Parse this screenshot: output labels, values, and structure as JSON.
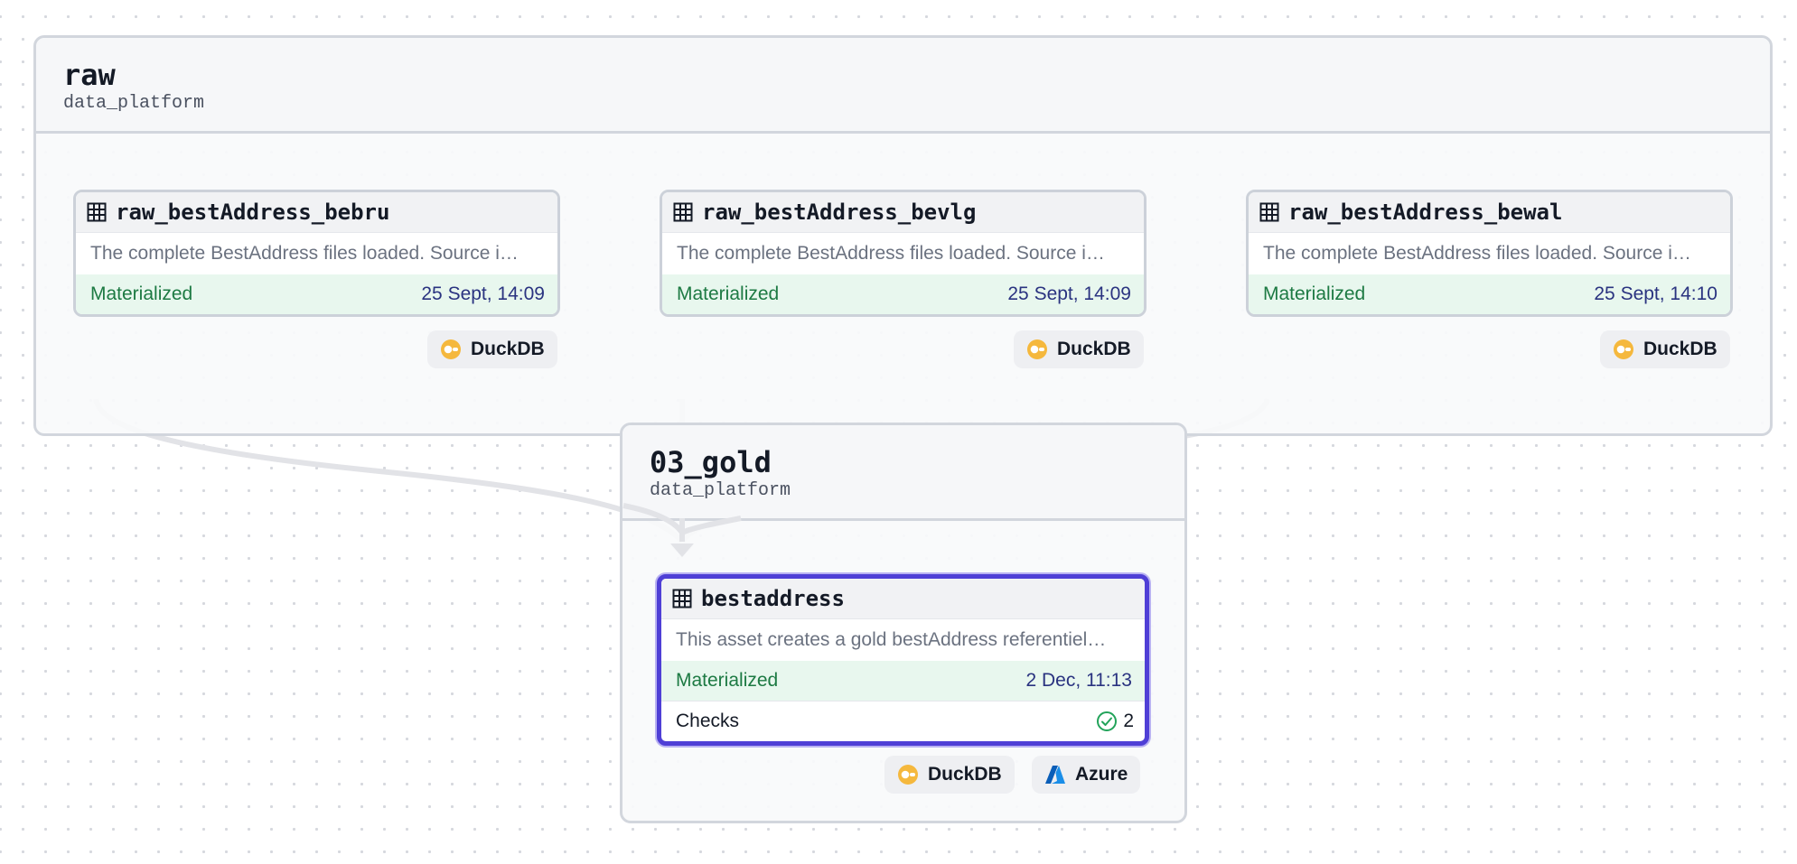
{
  "groups": [
    {
      "name": "raw",
      "location": "data_platform"
    },
    {
      "name": "03_gold",
      "location": "data_platform"
    }
  ],
  "assets": [
    {
      "name": "raw_bestAddress_bebru",
      "description": "The complete BestAddress files loaded. Source i…",
      "status": "Materialized",
      "timestamp": "25 Sept, 14:09",
      "tags": [
        "DuckDB"
      ]
    },
    {
      "name": "raw_bestAddress_bevlg",
      "description": "The complete BestAddress files loaded. Source i…",
      "status": "Materialized",
      "timestamp": "25 Sept, 14:09",
      "tags": [
        "DuckDB"
      ]
    },
    {
      "name": "raw_bestAddress_bewal",
      "description": "The complete BestAddress files loaded. Source i…",
      "status": "Materialized",
      "timestamp": "25 Sept, 14:10",
      "tags": [
        "DuckDB"
      ]
    },
    {
      "name": "bestaddress",
      "description": "This asset creates a gold bestAddress referentiel…",
      "status": "Materialized",
      "timestamp": "2 Dec, 11:13",
      "checks_label": "Checks",
      "checks_count": "2",
      "tags": [
        "DuckDB",
        "Azure"
      ]
    }
  ],
  "icons": {
    "asset": "table-icon",
    "duckdb": "duckdb-logo-icon",
    "azure": "azure-logo-icon",
    "check": "check-circle-icon"
  },
  "colors": {
    "selected_border": "#4f3fd6",
    "materialized_bg": "#e8f7ee",
    "materialized_text": "#1d7a43",
    "timestamp_text": "#2a3380",
    "duckdb": "#f5b83d",
    "azure": "#0078d4",
    "check_ok": "#22a35a"
  }
}
